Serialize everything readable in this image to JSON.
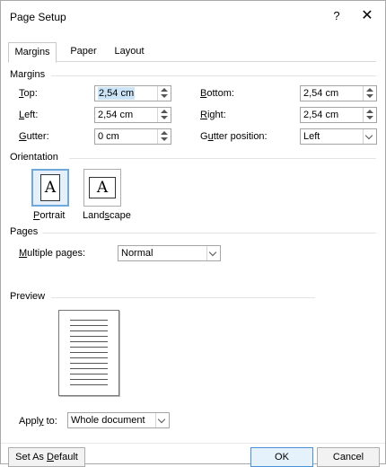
{
  "window": {
    "title": "Page Setup",
    "help_label": "?",
    "close_label": "✕"
  },
  "tabs": [
    {
      "label": "Margins",
      "active": true
    },
    {
      "label": "Paper",
      "active": false
    },
    {
      "label": "Layout",
      "active": false
    }
  ],
  "margins": {
    "group_label": "Margins",
    "top": {
      "label_u": "T",
      "label_rest": "op:",
      "value": "2,54 cm"
    },
    "left": {
      "label_u": "L",
      "label_rest": "eft:",
      "value": "2,54 cm"
    },
    "gutter": {
      "label_u": "G",
      "label_rest": "utter:",
      "value": "0 cm"
    },
    "bottom": {
      "label_u": "B",
      "label_rest": "ottom:",
      "value": "2,54 cm"
    },
    "right": {
      "label_u": "R",
      "label_rest": "ight:",
      "value": "2,54 cm"
    },
    "gutter_position": {
      "label_pre": "G",
      "label_u": "u",
      "label_rest": "tter position:",
      "value": "Left"
    }
  },
  "orientation": {
    "group_label": "Orientation",
    "portrait": {
      "label_u": "P",
      "label_rest": "ortrait",
      "selected": true
    },
    "landscape": {
      "label_pre": "Land",
      "label_u": "s",
      "label_rest": "cape",
      "selected": false
    },
    "glyph": "A"
  },
  "pages": {
    "group_label": "Pages",
    "multiple_pages": {
      "label_u": "M",
      "label_rest": "ultiple pages:",
      "value": "Normal"
    }
  },
  "preview": {
    "group_label": "Preview"
  },
  "apply_to": {
    "label_pre": "Appl",
    "label_u": "y",
    "label_rest": " to:",
    "value": "Whole document"
  },
  "buttons": {
    "set_default_pre": "Set As ",
    "set_default_u": "D",
    "set_default_rest": "efault",
    "ok": "OK",
    "cancel": "Cancel"
  }
}
